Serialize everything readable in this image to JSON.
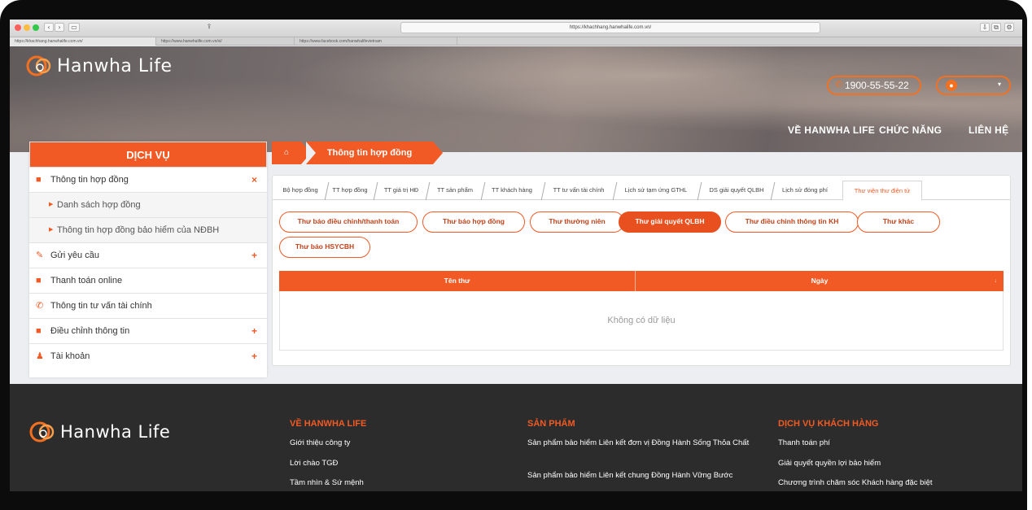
{
  "browser": {
    "url": "https://khachhang.hanwhalife.com.vn/",
    "tabs": [
      "https://khachhang.hanwhalife.com.vn/",
      "https://www.hanwhalife.com.vn/vi/",
      "https://www.facebook.com/hanwhalifevietnam"
    ]
  },
  "header": {
    "brand": "Hanwha Life",
    "phone": "1900-55-55-22",
    "nav": [
      "VỀ HANWHA LIFE",
      "CHỨC NĂNG",
      "LIÊN HỆ"
    ],
    "accent": "#f15a24"
  },
  "sidebar": {
    "title": "DỊCH VỤ",
    "items": [
      {
        "label": "Thông tin hợp đồng",
        "icon": "briefcase-icon",
        "sign": "×"
      },
      {
        "label": "Danh sách hợp đồng",
        "sub": true
      },
      {
        "label": "Thông tin hợp đồng bảo hiểm của NĐBH",
        "sub": true
      },
      {
        "label": "Gửi yêu cầu",
        "icon": "edit-icon",
        "sign": "+"
      },
      {
        "label": "Thanh toán online",
        "icon": "briefcase-icon",
        "sign": ""
      },
      {
        "label": "Thông tin tư vấn tài chính",
        "icon": "phone-icon",
        "sign": ""
      },
      {
        "label": "Điều chỉnh thông tin",
        "icon": "briefcase-icon",
        "sign": "+"
      },
      {
        "label": "Tài khoản",
        "icon": "user-icon",
        "sign": "+"
      }
    ]
  },
  "breadcrumb": {
    "current": "Thông tin hợp đồng"
  },
  "tabs": [
    "Bộ hợp đồng",
    "TT hợp đồng",
    "TT giá trị HĐ",
    "TT sản phẩm",
    "TT khách hàng",
    "TT tư vấn tài chính",
    "Lịch sử tạm ứng GTHL",
    "DS giải quyết QLBH",
    "Lịch sử đóng phí",
    "Thư viện thư điện tử"
  ],
  "letter_types": [
    "Thư báo điều chỉnh/thanh toán",
    "Thư báo hợp đồng",
    "Thư thường niên",
    "Thư giải quyết QLBH",
    "Thư điều chỉnh thông tin KH",
    "Thư khác",
    "Thư báo HSYCBH"
  ],
  "table": {
    "columns": [
      "Tên thư",
      "Ngày"
    ],
    "empty": "Không có dữ liệu"
  },
  "footer": {
    "brand": "Hanwha Life",
    "columns": [
      {
        "title": "VỀ HANWHA LIFE",
        "links": [
          "Giới thiệu công ty",
          "Lời chào TGĐ",
          "Tầm nhìn & Sứ mệnh"
        ]
      },
      {
        "title": "SẢN PHẨM",
        "links": [
          "Sản phẩm bảo hiểm Liên kết đơn vị Đồng Hành Sống Thỏa Chất",
          "Sản phẩm bảo hiểm Liên kết chung Đồng Hành Vững Bước"
        ]
      },
      {
        "title": "DỊCH VỤ KHÁCH HÀNG",
        "links": [
          "Thanh toán phí",
          "Giải quyết quyền lợi bảo hiểm",
          "Chương trình chăm sóc Khách hàng đặc biệt"
        ]
      }
    ]
  }
}
